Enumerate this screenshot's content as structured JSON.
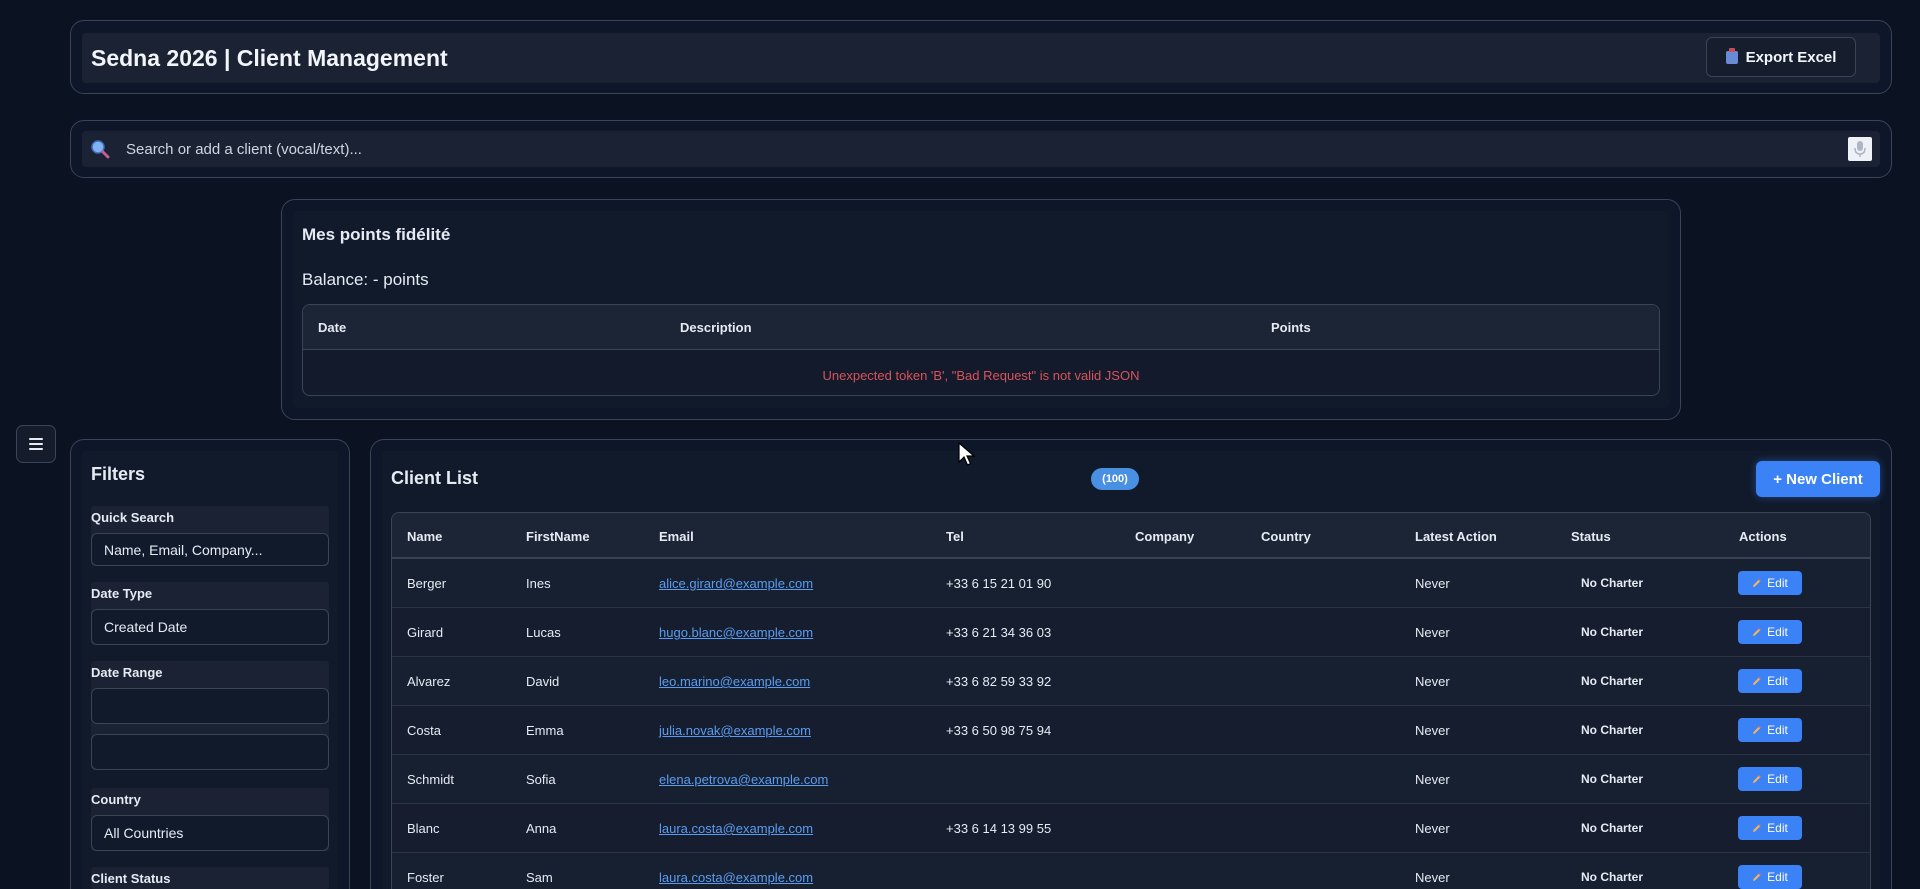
{
  "header": {
    "title": "Sedna 2026 | Client Management",
    "export_label": "Export Excel"
  },
  "search": {
    "placeholder": "Search or add a client (vocal/text)..."
  },
  "loyalty": {
    "title": "Mes points fidélité",
    "balance": "Balance: - points",
    "columns": [
      "Date",
      "Description",
      "Points"
    ],
    "error": "Unexpected token 'B', \"Bad Request\" is not valid JSON"
  },
  "filters": {
    "title": "Filters",
    "quick_search": {
      "label": "Quick Search",
      "placeholder": "Name, Email, Company..."
    },
    "date_type": {
      "label": "Date Type",
      "value": "Created Date"
    },
    "date_range": {
      "label": "Date Range"
    },
    "country": {
      "label": "Country",
      "value": "All Countries"
    },
    "client_status": {
      "label": "Client Status"
    }
  },
  "clients": {
    "title": "Client List",
    "count": "(100)",
    "new_label": "+ New Client",
    "columns": [
      "Name",
      "FirstName",
      "Email",
      "Tel",
      "Company",
      "Country",
      "Latest Action",
      "Status",
      "Actions"
    ],
    "edit_label": "Edit",
    "rows": [
      {
        "name": "Berger",
        "first": "Ines",
        "email": "alice.girard@example.com",
        "tel": "+33 6 15 21 01 90",
        "company": "",
        "country": "",
        "latest": "Never",
        "status": "No Charter"
      },
      {
        "name": "Girard",
        "first": "Lucas",
        "email": "hugo.blanc@example.com",
        "tel": "+33 6 21 34 36 03",
        "company": "",
        "country": "",
        "latest": "Never",
        "status": "No Charter"
      },
      {
        "name": "Alvarez",
        "first": "David",
        "email": "leo.marino@example.com",
        "tel": "+33 6 82 59 33 92",
        "company": "",
        "country": "",
        "latest": "Never",
        "status": "No Charter"
      },
      {
        "name": "Costa",
        "first": "Emma",
        "email": "julia.novak@example.com",
        "tel": "+33 6 50 98 75 94",
        "company": "",
        "country": "",
        "latest": "Never",
        "status": "No Charter"
      },
      {
        "name": "Schmidt",
        "first": "Sofia",
        "email": "elena.petrova@example.com",
        "tel": "",
        "company": "",
        "country": "",
        "latest": "Never",
        "status": "No Charter"
      },
      {
        "name": "Blanc",
        "first": "Anna",
        "email": "laura.costa@example.com",
        "tel": "+33 6 14 13 99 55",
        "company": "",
        "country": "",
        "latest": "Never",
        "status": "No Charter"
      },
      {
        "name": "Foster",
        "first": "Sam",
        "email": "laura.costa@example.com",
        "tel": "",
        "company": "",
        "country": "",
        "latest": "Never",
        "status": "No Charter"
      }
    ]
  },
  "icons": {
    "search": "search-icon",
    "mic": "microphone-icon",
    "menu": "hamburger-menu-icon",
    "export": "clipboard-icon",
    "edit": "pencil-icon"
  },
  "colors": {
    "background": "#0b1221",
    "accent": "#3b82f6",
    "error": "#d9535a",
    "link": "#5b9cf0"
  }
}
